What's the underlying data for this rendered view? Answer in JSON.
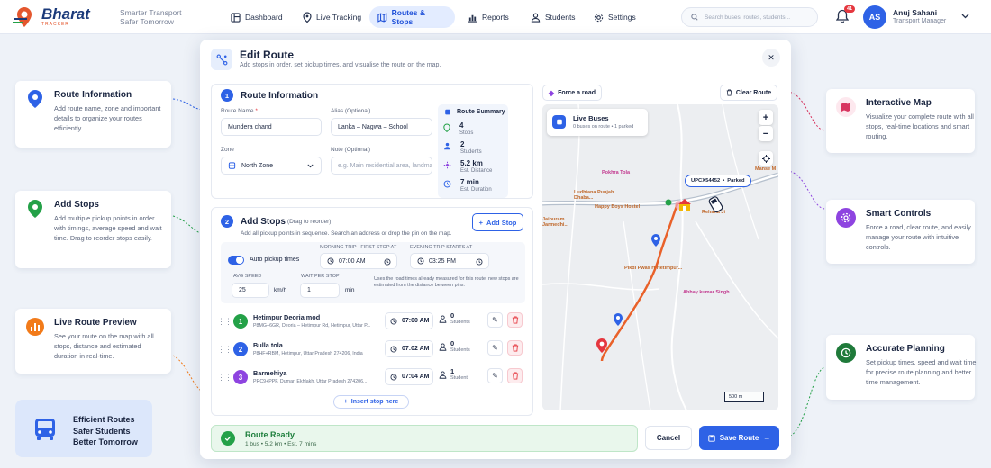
{
  "brand": {
    "name": "Bharat",
    "sub": "TRACKER",
    "tagline_1": "Smarter Transport",
    "tagline_2": "Safer Tomorrow"
  },
  "nav": {
    "items": [
      {
        "label": "Dashboard",
        "icon": "dashboard-icon"
      },
      {
        "label": "Live Tracking",
        "icon": "location-pin-icon"
      },
      {
        "label": "Routes & Stops",
        "icon": "map-icon",
        "active": true
      },
      {
        "label": "Reports",
        "icon": "chart-icon"
      },
      {
        "label": "Students",
        "icon": "users-icon"
      },
      {
        "label": "Settings",
        "icon": "gear-icon"
      }
    ],
    "search_placeholder": "Search buses, routes, students...",
    "notifications": "41",
    "user": {
      "initials": "AS",
      "name": "Anuj Sahani",
      "role": "Transport Manager"
    }
  },
  "left_features": [
    {
      "title": "Route Information",
      "desc": "Add route name, zone and important details to organize your routes efficiently.",
      "color": "#2e62e6"
    },
    {
      "title": "Add Stops",
      "desc": "Add multiple pickup points in order with timings, average speed and wait time. Drag to reorder stops easily.",
      "color": "#24a148"
    },
    {
      "title": "Live Route Preview",
      "desc": "See your route on the map with all stops, distance and estimated duration in real-time.",
      "color": "#f27b1a"
    }
  ],
  "right_features": [
    {
      "title": "Interactive Map",
      "desc": "Visualize your complete route with all stops, real-time locations and smart routing.",
      "color": "#d8345f"
    },
    {
      "title": "Smart Controls",
      "desc": "Force a road, clear route, and easily manage your route with intuitive controls.",
      "color": "#8e44e0"
    },
    {
      "title": "Accurate Planning",
      "desc": "Set pickup times, speed and wait time for precise route planning and better time management.",
      "color": "#24a148"
    }
  ],
  "promo": {
    "text": "Efficient Routes\nSafer Students\nBetter Tomorrow"
  },
  "modal": {
    "title": "Edit Route",
    "subtitle": "Add stops in order, set pickup times, and visualise the route on the map.",
    "route_info": {
      "step": "1",
      "title": "Route Information",
      "name_label": "Route Name",
      "name_req": "*",
      "name_value": "Mundera chand",
      "alias_label": "Alias (Optional)",
      "alias_value": "Lanka – Nagwa – School",
      "zone_label": "Zone",
      "zone_value": "North Zone",
      "note_label": "Note (Optional)",
      "note_placeholder": "e.g. Main residential area, landmark",
      "summary": {
        "title": "Route Summary",
        "stops_value": "4",
        "stops_label": "Stops",
        "students_value": "2",
        "students_label": "Students",
        "distance_value": "5.2 km",
        "distance_label": "Est. Distance",
        "duration_value": "7 min",
        "duration_label": "Est. Duration"
      }
    },
    "add_stops": {
      "step": "2",
      "title": "Add Stops",
      "hint": "(Drag to reorder)",
      "desc": "Add all pickup points in sequence. Search an address or drop the pin on the map.",
      "add_button": "Add Stop",
      "auto_pickup_label": "Auto pickup times",
      "morning_label": "MORNING TRIP - FIRST STOP AT",
      "morning_value": "07:00 AM",
      "evening_label": "EVENING TRIP STARTS AT",
      "evening_value": "03:25 PM",
      "speed_label": "AVG SPEED",
      "speed_value": "25",
      "speed_unit": "km/h",
      "wait_label": "WAIT PER STOP",
      "wait_value": "1",
      "wait_unit": "min",
      "note": "Uses the road times already measured for this route; new stops are estimated from the distance between pins.",
      "stops": [
        {
          "num": "1",
          "color": "#24a148",
          "name": "Hetimpur Deoria mod",
          "address": "P8MG+6GR, Deoria – Hetimpur Rd, Hetimpur, Uttar P...",
          "time": "07:00 AM",
          "students": "0",
          "students_label": "Students"
        },
        {
          "num": "2",
          "color": "#2e62e6",
          "name": "Bulla tola",
          "address": "P8HF+RBM, Hetimpur, Uttar Pradesh 274206, India",
          "time": "07:02 AM",
          "students": "0",
          "students_label": "Students"
        },
        {
          "num": "3",
          "color": "#8e44e0",
          "name": "Barmehiya",
          "address": "PRC9+PPF, Dumari Ekhlakh, Uttar Pradesh 274206,...",
          "time": "07:04 AM",
          "students": "1",
          "students_label": "Student"
        }
      ],
      "insert_label": "Insert stop here"
    },
    "map": {
      "force_road": "Force a road",
      "clear_route": "Clear Route",
      "live_buses_title": "Live Buses",
      "live_buses_sub": "0 buses on route • 1 parked",
      "bus_tag": "UPCX54452",
      "bus_status": "Parked",
      "scale": "500 m",
      "places": [
        {
          "name": "Pokhra Tola",
          "kind": "pink"
        },
        {
          "name": "Ludhiana Punjab Dhaba...",
          "kind": "orange"
        },
        {
          "name": "Happy Boys Hostel",
          "kind": "orange"
        },
        {
          "name": "Rehana Ji",
          "kind": "orange"
        },
        {
          "name": "Pikdi Pwas H Hetimpur...",
          "kind": "orange"
        },
        {
          "name": "Abhay kumar Singh",
          "kind": "pink"
        },
        {
          "name": "Manse M",
          "kind": "orange"
        },
        {
          "name": "Jaiburam Jarmedhi...",
          "kind": "orange"
        }
      ]
    },
    "footer": {
      "ready_title": "Route Ready",
      "ready_desc": "1 bus • 5.2 km • Est. 7 mins",
      "cancel": "Cancel",
      "save": "Save Route"
    }
  }
}
